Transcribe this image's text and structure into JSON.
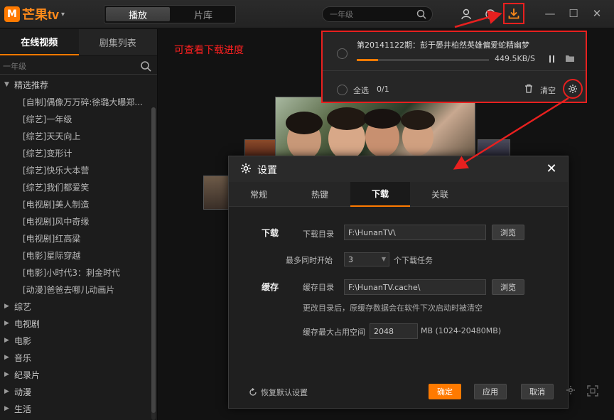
{
  "app": {
    "logo_badge": "M",
    "logo_text": "芒果tv",
    "logo_caret": "▾"
  },
  "topbar": {
    "tabs": [
      "播放",
      "片库"
    ],
    "search_placeholder": "一年级",
    "download_tooltip": "下载",
    "win_controls": [
      "—",
      "☐",
      "✕"
    ]
  },
  "sidebar": {
    "tabs": [
      "在线视频",
      "剧集列表"
    ],
    "search_placeholder": "一年级",
    "featured_label": "精选推荐",
    "featured_items": [
      "[自制]偶像万万碎:徐璐大曝郑...",
      "[综艺]一年级",
      "[综艺]天天向上",
      "[综艺]变形计",
      "[综艺]快乐大本营",
      "[综艺]我们都爱笑",
      "[电视剧]美人制造",
      "[电视剧]风中奇缘",
      "[电视剧]红高粱",
      "[电影]星际穿越",
      "[电影]小时代3：刺金时代",
      "[动漫]爸爸去哪儿动画片"
    ],
    "categories": [
      "综艺",
      "电视剧",
      "电影",
      "音乐",
      "纪录片",
      "动漫",
      "生活"
    ]
  },
  "annotation": "可查看下载进度",
  "download_panel": {
    "title": "第20141122期：彭于晏井柏然英雄偏爱蛇精幽梦",
    "progress_fraction": 0.16,
    "speed": "449.5KB/S",
    "select_all": "全选",
    "count": "0/1",
    "clear": "清空"
  },
  "settings": {
    "title": "设置",
    "close": "✕",
    "tabs": [
      "常规",
      "热键",
      "下载",
      "关联"
    ],
    "active_tab": 2,
    "download_section": "下载",
    "download_dir_label": "下载目录",
    "download_dir_value": "F:\\HunanTV\\",
    "browse": "浏览",
    "max_tasks_label": "最多同时开始",
    "max_tasks_value": "3",
    "max_tasks_suffix": "个下载任务",
    "cache_section": "缓存",
    "cache_dir_label": "缓存目录",
    "cache_dir_value": "F:\\HunanTV.cache\\",
    "cache_hint": "更改目录后，原缓存数据会在软件下次启动时被清空",
    "cache_max_label": "缓存最大占用空间",
    "cache_max_value": "2048",
    "cache_max_unit": "MB (1024-20480MB)",
    "restore": "恢复默认设置",
    "ok": "确定",
    "apply": "应用",
    "cancel": "取消"
  },
  "colors": {
    "accent": "#ff7a00",
    "highlight_red": "#e8201f"
  }
}
